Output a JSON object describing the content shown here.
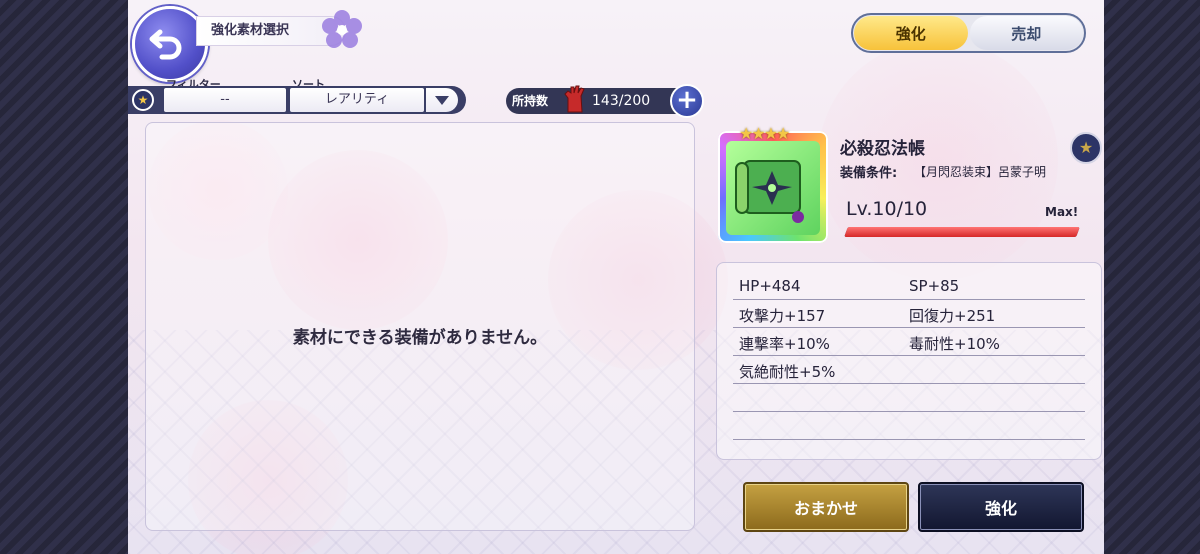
{
  "header": {
    "back_icon": "back-arrow-icon",
    "title": "強化素材選択"
  },
  "tabs": [
    {
      "label": "強化",
      "active": true
    },
    {
      "label": "売却",
      "active": false
    }
  ],
  "filter": {
    "label": "フィルター",
    "value": "--",
    "star_icon": "star-icon"
  },
  "sort": {
    "label": "ソート",
    "value": "レアリティ"
  },
  "inventory": {
    "label": "所持数",
    "icon": "glove-icon",
    "value": "143/200",
    "add_icon": "plus-icon"
  },
  "material_list": {
    "empty_message": "素材にできる装備がありません。"
  },
  "equipment": {
    "name": "必殺忍法帳",
    "stars": "★★★★",
    "condition_label": "装備条件:",
    "condition_value": "【月閃忍装束】呂蒙子明",
    "level": "Lv.10/10",
    "max_label": "Max!",
    "level_progress": 1.0,
    "rarity_icon": "star-icon"
  },
  "stats": [
    [
      "HP+484",
      "SP+85"
    ],
    [
      "攻撃力+157",
      "回復力+251"
    ],
    [
      "連撃率+10%",
      "毒耐性+10%"
    ],
    [
      "気絶耐性+5%",
      ""
    ],
    [
      "",
      ""
    ],
    [
      "",
      ""
    ]
  ],
  "buttons": {
    "auto": "おまかせ",
    "enhance": "強化"
  },
  "colors": {
    "tab_active": "#f7c23a",
    "auto_button": "#8c6a1c",
    "enhance_button": "#121630",
    "level_bar": "#d62828"
  }
}
